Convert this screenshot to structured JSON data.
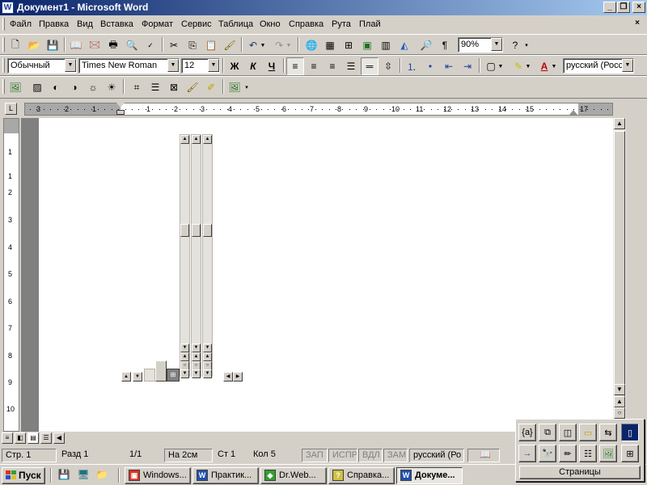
{
  "window": {
    "title": "Документ1 - Microsoft Word",
    "app_icon": "W",
    "min": "_",
    "restore": "❐",
    "close": "×"
  },
  "menu": {
    "items": [
      "Файл",
      "Правка",
      "Вид",
      "Вставка",
      "Формат",
      "Сервис",
      "Таблица",
      "Окно",
      "Справка",
      "Рута",
      "Плай"
    ],
    "close": "×"
  },
  "standard_toolbar": {
    "zoom": "90%"
  },
  "format_toolbar": {
    "style": "Обычный",
    "font": "Times New Roman",
    "size": "12",
    "bold": "Ж",
    "italic": "К",
    "underline": "Ч",
    "language": "русский (Росси"
  },
  "ruler": {
    "numbers": [
      "3",
      "2",
      "1",
      "1",
      "2",
      "3",
      "4",
      "5",
      "6",
      "7",
      "8",
      "9",
      "10",
      "11",
      "12",
      "13",
      "14",
      "15",
      "17"
    ],
    "vnumbers": [
      "1",
      "1",
      "2",
      "3",
      "4",
      "5",
      "6",
      "7",
      "8",
      "9",
      "10"
    ]
  },
  "status": {
    "page": "Стр. 1",
    "section": "Разд 1",
    "pages": "1/1",
    "at": "На 2см",
    "line": "Ст 1",
    "col": "Кол 5",
    "rec": "ЗАП",
    "trk": "ИСПР",
    "ext": "ВДЛ",
    "ovr": "ЗАМ",
    "lang": "русский (Ро"
  },
  "taskbar": {
    "start": "Пуск",
    "tasks": [
      "Windows...",
      "Практик...",
      "Dr.Web...",
      "Справка...",
      "Докуме..."
    ]
  },
  "palette": {
    "pages_button": "Страницы",
    "field_label": "{a}"
  },
  "colors": {
    "title_start": "#0a246a",
    "title_end": "#a6caf0",
    "face": "#d4d0c8",
    "doc_bg": "#808080"
  }
}
